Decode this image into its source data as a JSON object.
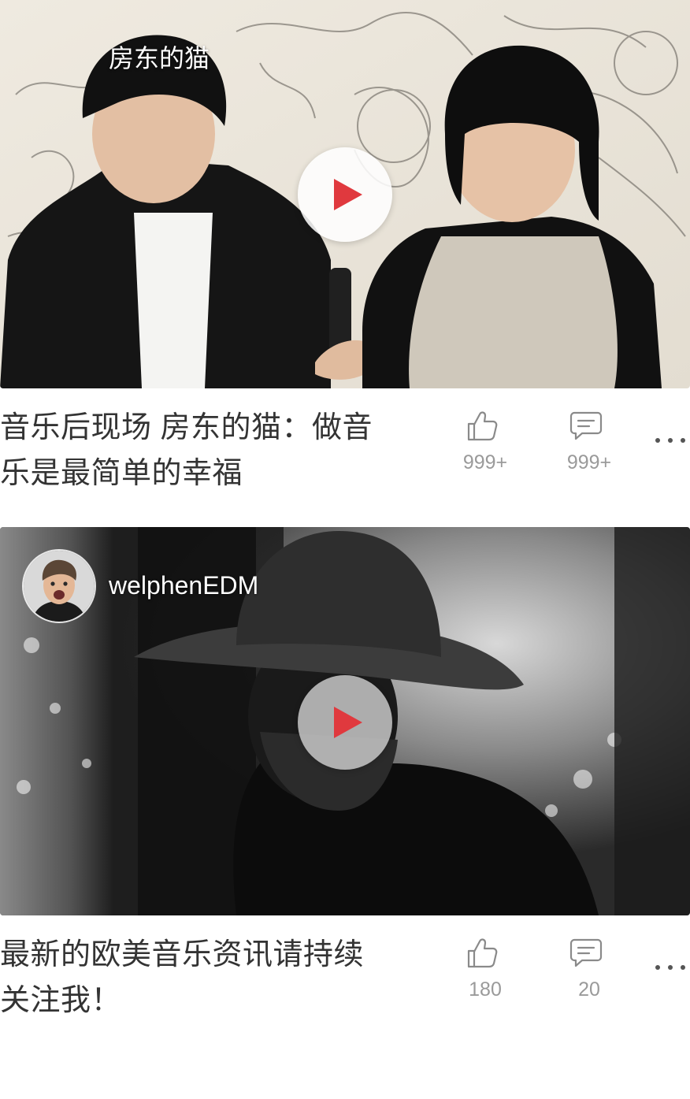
{
  "feed": {
    "cards": [
      {
        "author": "房东的猫",
        "title_line1": "音乐后现场 房东的猫：做音",
        "title_line2": "乐是最简单的幸福",
        "likes": "999+",
        "comments": "999+"
      },
      {
        "author": "welphenEDM",
        "title_line1": "最新的欧美音乐资讯请持续",
        "title_line2": "关注我！",
        "likes": "180",
        "comments": "20"
      }
    ]
  },
  "icons": {
    "play": "play-icon",
    "like": "thumbs-up-icon",
    "comment": "comment-icon",
    "more": "more-dots-icon"
  },
  "colors": {
    "play_accent": "#e0393e",
    "count_text": "#9a9a9a",
    "title_text": "#333333"
  }
}
